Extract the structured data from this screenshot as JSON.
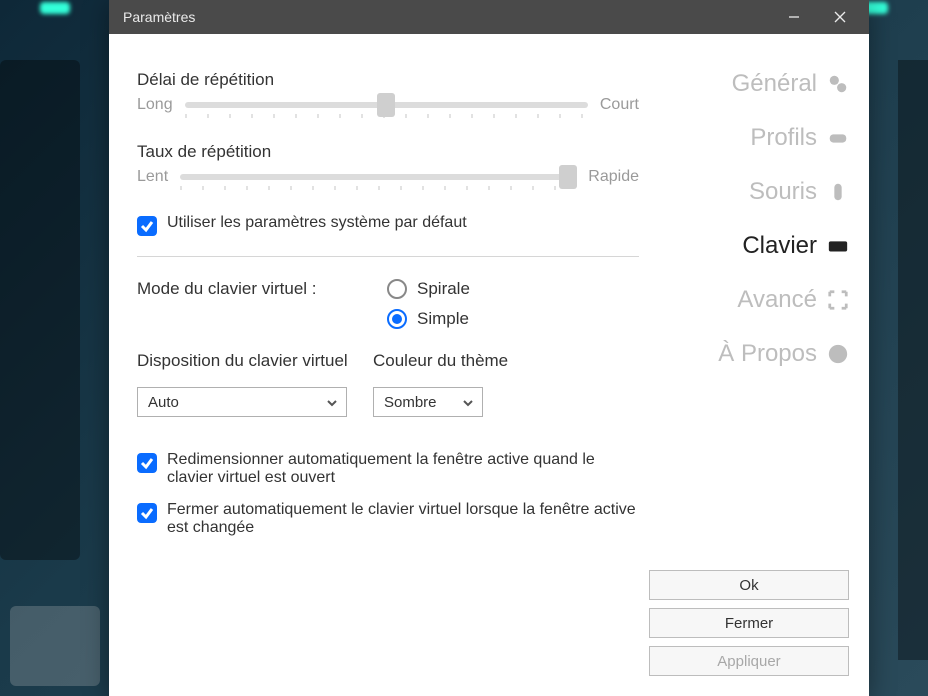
{
  "window": {
    "title": "Paramètres"
  },
  "repeat_delay": {
    "label": "Délai de répétition",
    "min_label": "Long",
    "max_label": "Court",
    "percent": 50
  },
  "repeat_rate": {
    "label": "Taux de répétition",
    "min_label": "Lent",
    "max_label": "Rapide",
    "percent": 98
  },
  "use_system_defaults": {
    "label": "Utiliser les paramètres système par défaut",
    "checked": true
  },
  "vk_mode": {
    "label": "Mode du clavier virtuel :",
    "options": {
      "spiral": "Spirale",
      "simple": "Simple"
    },
    "selected": "simple"
  },
  "vk_layout": {
    "label": "Disposition du clavier virtuel",
    "value": "Auto"
  },
  "theme_color": {
    "label": "Couleur du thème",
    "value": "Sombre"
  },
  "resize_when_open": {
    "label": "Redimensionner automatiquement la fenêtre active quand le clavier virtuel est ouvert",
    "checked": true
  },
  "close_on_window_change": {
    "label": "Fermer automatiquement le clavier virtuel lorsque la fenêtre active est changée",
    "checked": true
  },
  "nav": {
    "general": "Général",
    "profiles": "Profils",
    "mouse": "Souris",
    "keyboard": "Clavier",
    "advanced": "Avancé",
    "about": "À Propos",
    "active": "keyboard"
  },
  "buttons": {
    "ok": "Ok",
    "close": "Fermer",
    "apply": "Appliquer"
  }
}
